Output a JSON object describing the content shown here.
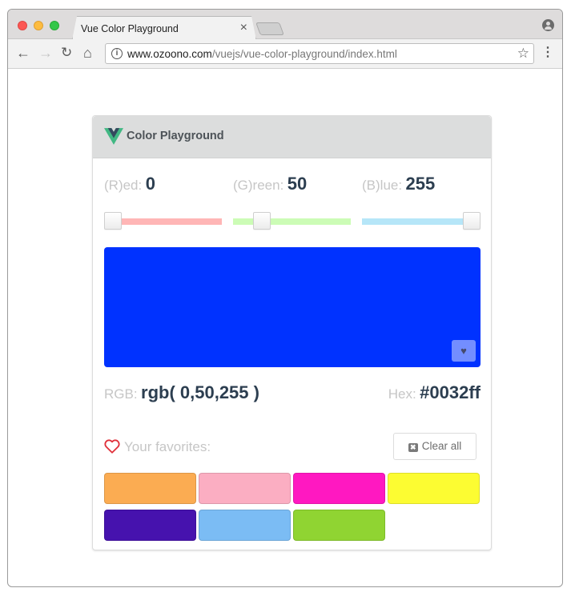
{
  "browser": {
    "tab_title": "Vue Color Playground",
    "tab_close": "×",
    "url_host": "www.ozoono.com",
    "url_path": "/vuejs/vue-color-playground/index.html",
    "icons": {
      "back": "←",
      "forward": "→",
      "reload": "↻",
      "home": "⌂",
      "info": "i",
      "star": "☆",
      "menu": "⋮"
    }
  },
  "app": {
    "title": "Color Playground",
    "channels": [
      {
        "label": "(R)ed:",
        "value": "0",
        "track_color": "#ffb6b6",
        "fraction": 0.0
      },
      {
        "label": "(G)reen:",
        "value": "50",
        "track_color": "#ccfcb6",
        "fraction": 0.196
      },
      {
        "label": "(B)lue:",
        "value": "255",
        "track_color": "#b6e6f8",
        "fraction": 1.0
      }
    ],
    "preview_color": "#0032ff",
    "favorite_icon": "♥",
    "rgb_label": "RGB:",
    "rgb_value": "rgb( 0,50,255 )",
    "hex_label": "Hex:",
    "hex_value": "#0032ff",
    "favorites_label": "Your favorites:",
    "clear_all_label": "Clear all",
    "clear_icon": "✖",
    "favorites": [
      "#fbac52",
      "#fbaec2",
      "#ff18c1",
      "#fcfc32",
      "#4612ae",
      "#7bbcf4",
      "#90d432"
    ]
  }
}
